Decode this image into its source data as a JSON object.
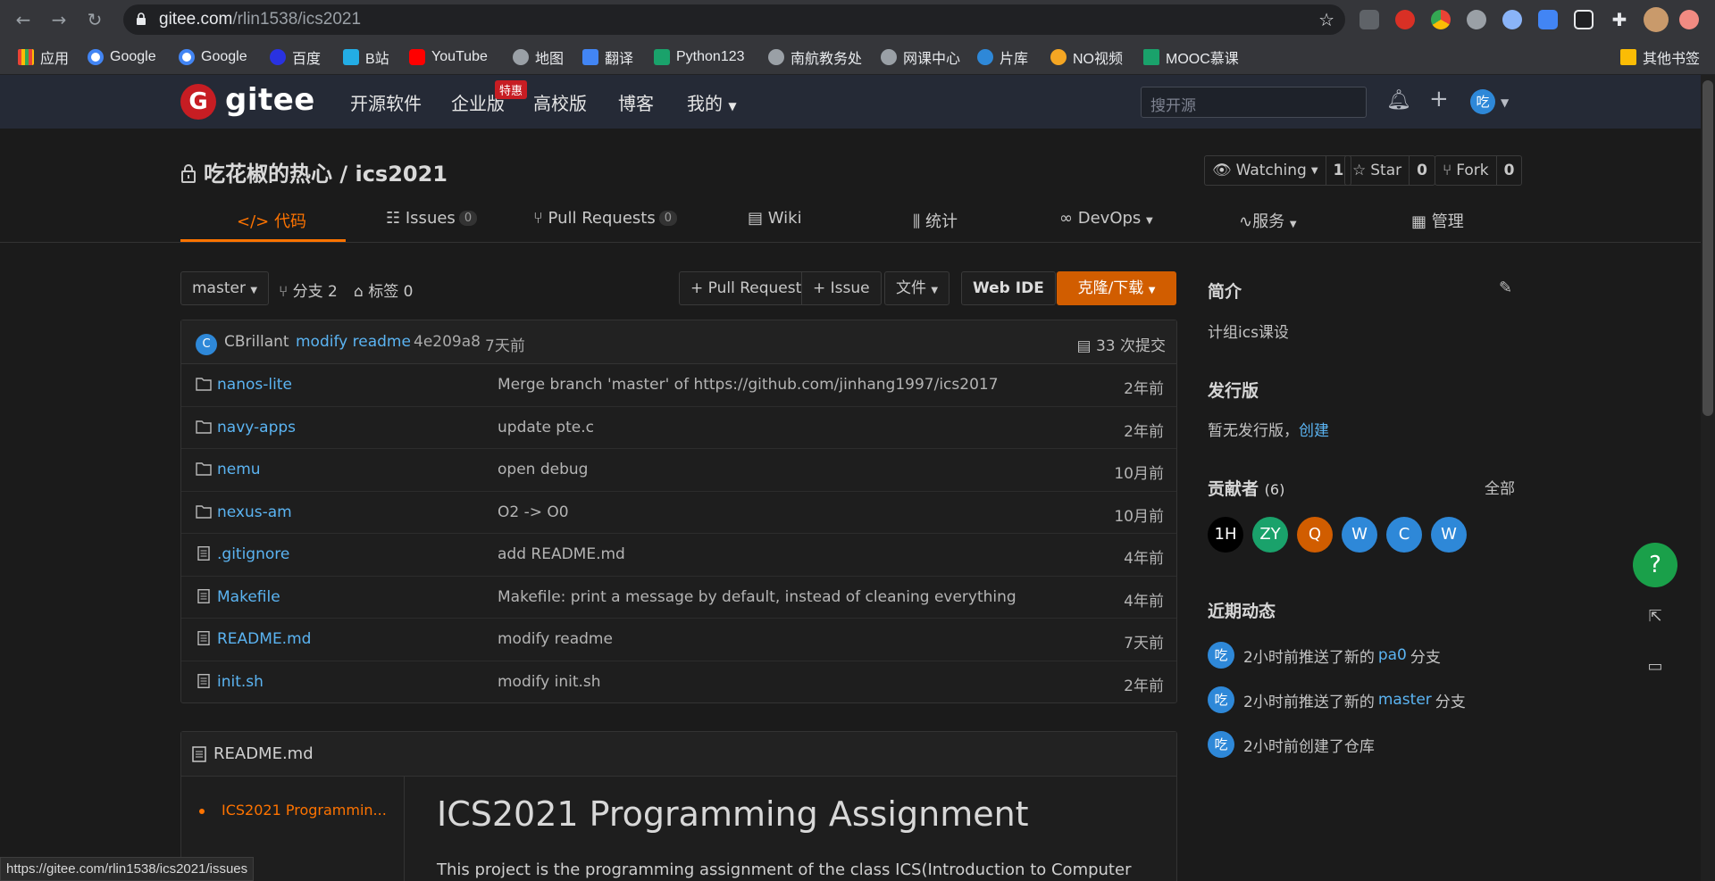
{
  "browser": {
    "url_host": "gitee.com",
    "url_path": "/rlin1538/ics2021",
    "bookmarks": [
      "应用",
      "Google",
      "Google",
      "百度",
      "B站",
      "YouTube",
      "地图",
      "翻译",
      "Python123",
      "南航教务处",
      "网课中心",
      "片库",
      "NO视频",
      "MOOC慕课"
    ],
    "bookmarks_other": "其他书签",
    "status_url": "https://gitee.com/rlin1538/ics2021/issues"
  },
  "header": {
    "logo_mark": "G",
    "logo_text": "gitee",
    "nav": [
      "开源软件",
      "企业版",
      "高校版",
      "博客",
      "我的"
    ],
    "special_badge": "特惠",
    "search_placeholder": "搜开源",
    "user_avatar": "吃"
  },
  "repo": {
    "title": "吃花椒的热心 / ics2021",
    "watching_label": "Watching",
    "watching_count": "1",
    "star_label": "Star",
    "star_count": "0",
    "fork_label": "Fork",
    "fork_count": "0"
  },
  "tabs": {
    "code": "代码",
    "issues": "Issues",
    "issues_count": "0",
    "pulls": "Pull Requests",
    "pulls_count": "0",
    "wiki": "Wiki",
    "stats": "统计",
    "devops": "DevOps",
    "service": "服务",
    "manage": "管理"
  },
  "toolbar": {
    "branch": "master",
    "branches": "分支 2",
    "tags": "标签 0",
    "pull_request": "+ Pull Request",
    "issue": "+ Issue",
    "file": "文件",
    "web_ide": "Web IDE",
    "clone": "克隆/下载"
  },
  "latest_commit": {
    "avatar": "C",
    "author": "CBrillant",
    "message": "modify readme",
    "hash": "4e209a8",
    "time": "7天前",
    "commits": "33 次提交"
  },
  "files": [
    {
      "type": "folder",
      "name": "nanos-lite",
      "message": "Merge branch 'master' of https://github.com/jinhang1997/ics2017",
      "time": "2年前"
    },
    {
      "type": "folder",
      "name": "navy-apps",
      "message": "update pte.c",
      "time": "2年前"
    },
    {
      "type": "folder",
      "name": "nemu",
      "message": "open debug",
      "time": "10月前"
    },
    {
      "type": "folder",
      "name": "nexus-am",
      "message": "O2 -> O0",
      "time": "10月前"
    },
    {
      "type": "file",
      "name": ".gitignore",
      "message": "add README.md",
      "time": "4年前"
    },
    {
      "type": "file",
      "name": "Makefile",
      "message": "Makefile: print a message by default, instead of cleaning everything",
      "time": "4年前"
    },
    {
      "type": "file",
      "name": "README.md",
      "message": "modify readme",
      "time": "7天前"
    },
    {
      "type": "file",
      "name": "init.sh",
      "message": "modify init.sh",
      "time": "2年前"
    }
  ],
  "readme": {
    "title": "README.md",
    "toc_item": "ICS2021 Programmin...",
    "heading": "ICS2021 Programming Assignment",
    "paragraph": "This project is the programming assignment of the class ICS(Introduction to Computer"
  },
  "sidebar": {
    "intro_title": "简介",
    "intro_text": "计组ics课设",
    "release_title": "发行版",
    "release_text": "暂无发行版，",
    "release_link": "创建",
    "contrib_title": "贡献者",
    "contrib_count": "(6)",
    "contrib_all": "全部",
    "contributors": [
      {
        "label": "1H",
        "color": "#000000"
      },
      {
        "label": "ZY",
        "color": "#1aa26b"
      },
      {
        "label": "Q",
        "color": "#d15d00"
      },
      {
        "label": "W",
        "color": "#2e88d8"
      },
      {
        "label": "C",
        "color": "#2e88d8"
      },
      {
        "label": "W",
        "color": "#2e88d8"
      }
    ],
    "activity_title": "近期动态",
    "activities": [
      {
        "avatar": "吃",
        "prefix": "2小时前推送了新的",
        "link": "pa0",
        "suffix": "分支"
      },
      {
        "avatar": "吃",
        "prefix": "2小时前推送了新的",
        "link": "master",
        "suffix": "分支"
      },
      {
        "avatar": "吃",
        "prefix": "2小时前创建了仓库",
        "link": "",
        "suffix": ""
      }
    ]
  },
  "help_button": "?",
  "colors": {
    "accent": "#fe7300",
    "brand": "#c71d23",
    "link": "#5bb4f2",
    "clone": "#d15d00"
  }
}
